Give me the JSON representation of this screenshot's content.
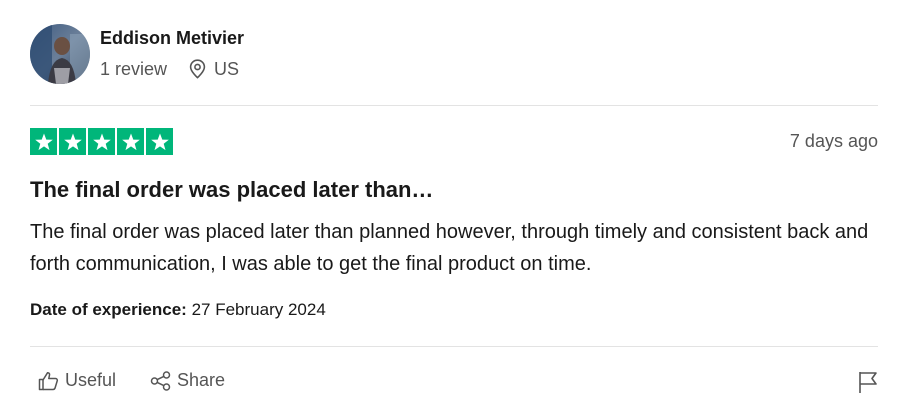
{
  "reviewer": {
    "name": "Eddison Metivier",
    "reviews": "1 review",
    "location": "US"
  },
  "rating": {
    "stars": 5,
    "max": 5,
    "color": "#00b67a"
  },
  "review": {
    "posted": "7 days ago",
    "title": "The final order was placed later than…",
    "body": "The final order was placed later than planned however, through timely and consistent back and forth communication, I was able to get the final product on time.",
    "experience_label": "Date of experience:",
    "experience_date": "27 February 2024"
  },
  "actions": {
    "useful": "Useful",
    "share": "Share"
  },
  "icons": {
    "location": "map-pin-icon",
    "useful": "thumbs-up-icon",
    "share": "share-icon",
    "report": "flag-icon"
  }
}
